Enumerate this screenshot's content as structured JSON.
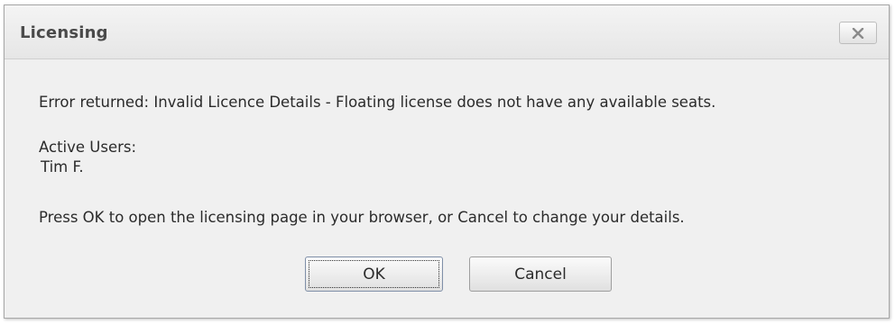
{
  "window": {
    "title": "Licensing",
    "close_icon": "close-x-icon"
  },
  "message": {
    "error": "Error returned: Invalid Licence Details - Floating license does not have any available seats.",
    "active_users_label": "Active Users:",
    "active_users": [
      "Tim F."
    ],
    "instruction": "Press OK to open the licensing page in your browser, or Cancel to change your details."
  },
  "buttons": {
    "ok_label": "OK",
    "cancel_label": "Cancel"
  },
  "colors": {
    "window_background": "#f0f0f0",
    "title_text": "#4a4a4a",
    "body_text": "#2b2b2b"
  }
}
